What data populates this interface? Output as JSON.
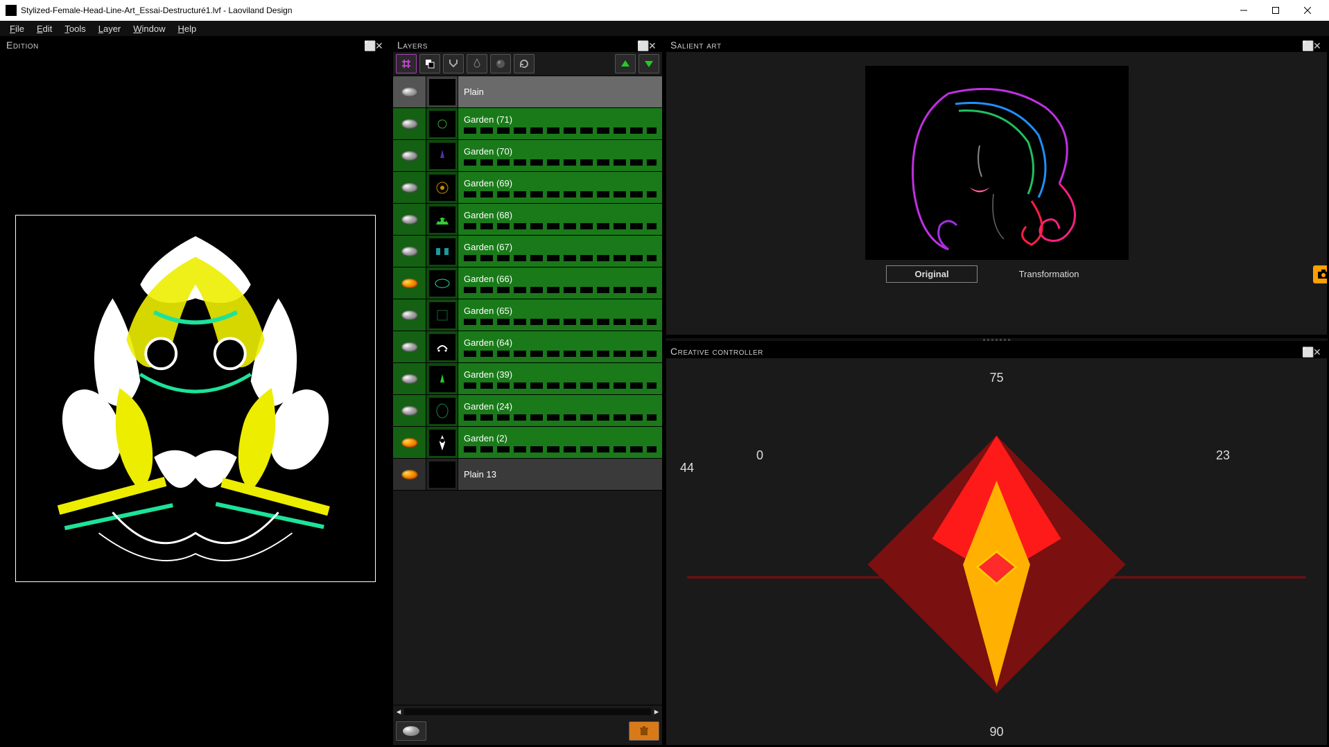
{
  "window": {
    "title": "Stylized-Female-Head-Line-Art_Essai-Destructuré1.lvf - Laoviland Design"
  },
  "menu": {
    "file": "File",
    "edit": "Edit",
    "tools": "Tools",
    "layer": "Layer",
    "window": "Window",
    "help": "Help"
  },
  "panels": {
    "edition": "Edition",
    "layers": "Layers",
    "salient": "Salient art",
    "creative": "Creative controller"
  },
  "layers": [
    {
      "name": "Plain",
      "style": "grey",
      "eye": "plain",
      "track": false
    },
    {
      "name": "Garden (71)",
      "style": "green",
      "eye": "plain",
      "track": true
    },
    {
      "name": "Garden (70)",
      "style": "green",
      "eye": "plain",
      "track": true
    },
    {
      "name": "Garden (69)",
      "style": "green",
      "eye": "plain",
      "track": true
    },
    {
      "name": "Garden (68)",
      "style": "green",
      "eye": "plain",
      "track": true
    },
    {
      "name": "Garden (67)",
      "style": "green",
      "eye": "plain",
      "track": true
    },
    {
      "name": "Garden (66)",
      "style": "green",
      "eye": "fire",
      "track": true
    },
    {
      "name": "Garden (65)",
      "style": "green",
      "eye": "plain",
      "track": true
    },
    {
      "name": "Garden (64)",
      "style": "green",
      "eye": "plain",
      "track": true
    },
    {
      "name": "Garden (39)",
      "style": "green",
      "eye": "plain",
      "track": true
    },
    {
      "name": "Garden (24)",
      "style": "green",
      "eye": "plain",
      "track": true
    },
    {
      "name": "Garden (2)",
      "style": "green",
      "eye": "fire",
      "track": true
    },
    {
      "name": "Plain 13",
      "style": "darkgrey",
      "eye": "fire",
      "track": false
    }
  ],
  "salient": {
    "tab_original": "Original",
    "tab_transformation": "Transformation"
  },
  "creative": {
    "top": "75",
    "right": "23",
    "bottom": "90",
    "left": "0",
    "far_left": "44"
  }
}
